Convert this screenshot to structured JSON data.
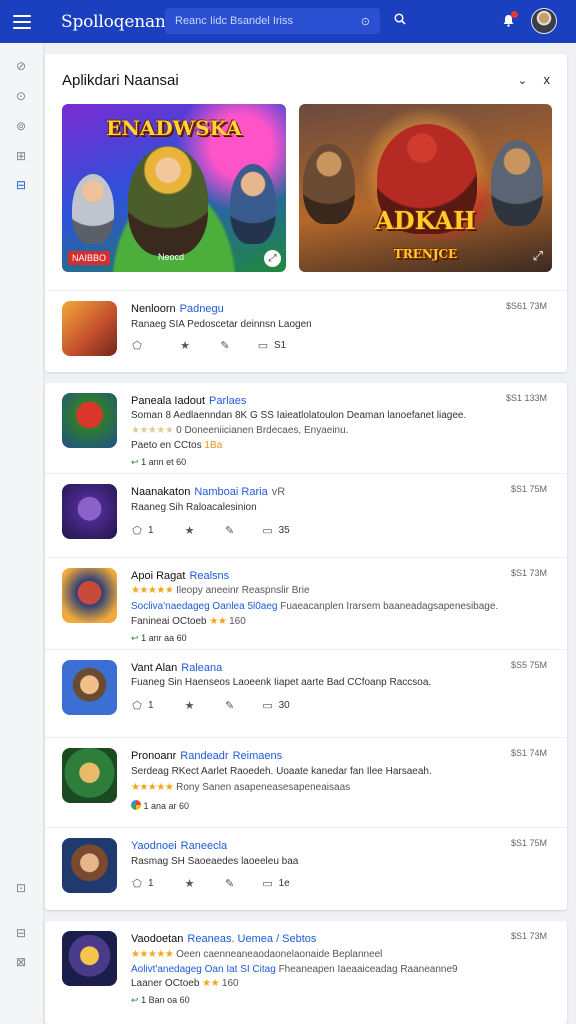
{
  "header": {
    "brand": "Spolloqenan",
    "search_placeholder": "Reanc Iidc Bsandel Iriss",
    "search_clear": "⊙",
    "search_icon": "search-icon",
    "notify_icon": "bell-icon"
  },
  "sidebar": {
    "items": [
      "⊘",
      "⊙",
      "⊚",
      "⊞",
      "⊟"
    ],
    "bottom": [
      "⊡",
      "⊟",
      "⊠"
    ]
  },
  "panel": {
    "title": "Aplikdari Naansai",
    "collapse": "⌄",
    "close": "x",
    "banner1": {
      "title": "ENADWSKA",
      "badge": "NAIBBO",
      "caption": "Neocd"
    },
    "banner2": {
      "title": "ADKAH",
      "subtitle": "TRENJCE"
    },
    "featured": {
      "name": "Nenloorn",
      "tag": "Padnegu",
      "desc": "Ranaeg SIA Pedoscetar deinnsn Laogen",
      "price": "$S61 73M",
      "count": "S1"
    }
  },
  "apps": [
    {
      "name": "Paneala Iadout",
      "tag": "Parlaes",
      "price": "$S1 133M",
      "desc": "Soman 8 Aedlaenndan 8K G SS Iaieatlolatoulon Deaman lanoefanet liagee.",
      "rating_text": "0 Doneeniicianen Brdecaes, Enyaeinu.",
      "meta": "Paeto en CCtos",
      "meta_tag": "1Ba",
      "stat": "1 ann et 60"
    },
    {
      "name": "Naanakaton",
      "tag": "Namboai Raria",
      "sub": "vR",
      "price": "$S1 75M",
      "desc": "Raaneg Sih Raloacalesinion",
      "count_a": "1",
      "count_b": "35"
    },
    {
      "name": "Apoi Ragat",
      "tag": "Realsns",
      "price": "$S1 73M",
      "desc": "Ileopy aneeinr Reaspnslir Brie",
      "desc_blue": "Socliva'naedageg Oanlea 5l0aeg",
      "desc_gray": "Fuaeacanplen Irarsem baaneadagsapenesibage.",
      "meta": "Fanineai OCtoeb",
      "meta_tag": "160",
      "stat": "1 anr aa 60"
    },
    {
      "name": "Vant Alan",
      "tag": "Raleana",
      "price": "$S5 75M",
      "desc": "Fuaneg Sin Haenseos Laoeenk Iiapet aarte Bad CCfoanp Raccsoa.",
      "count_a": "1",
      "count_b": "30"
    },
    {
      "name": "Pronoanr",
      "tag": "Randeadr",
      "sub": "Reimaens",
      "price": "$S1 74M",
      "desc": "Serdeag RKect Aarlet Raoedeh. Uoaate kanedar fan Ilee Harsaeah.",
      "rating_text": "Rony Sanen asapeneasesapeneaisaas",
      "stat": "1 ana ar 60"
    },
    {
      "name": "Yaodnoei",
      "tag": "Raneecla",
      "price": "$S1 75M",
      "desc": "Rasmag SH Saoeaedes laoeeleu baa",
      "count_a": "1",
      "count_b": "1e"
    }
  ],
  "app_last": {
    "name": "Vaodoetan",
    "tag": "Reaneas. Uemea / Sebtos",
    "price": "$S1 73M",
    "rating_text": "Oeen caenneaneaodaonelaonaide Beplanneel",
    "desc_blue": "Aolivt'anedageg Oan Iat SI Citag",
    "desc_gray": "Fheaneapen Iaeaaiceadag Raaneanne9",
    "meta": "Laaner OCtoeb",
    "meta_tag": "160",
    "stat": "1 Ban oa 60"
  }
}
